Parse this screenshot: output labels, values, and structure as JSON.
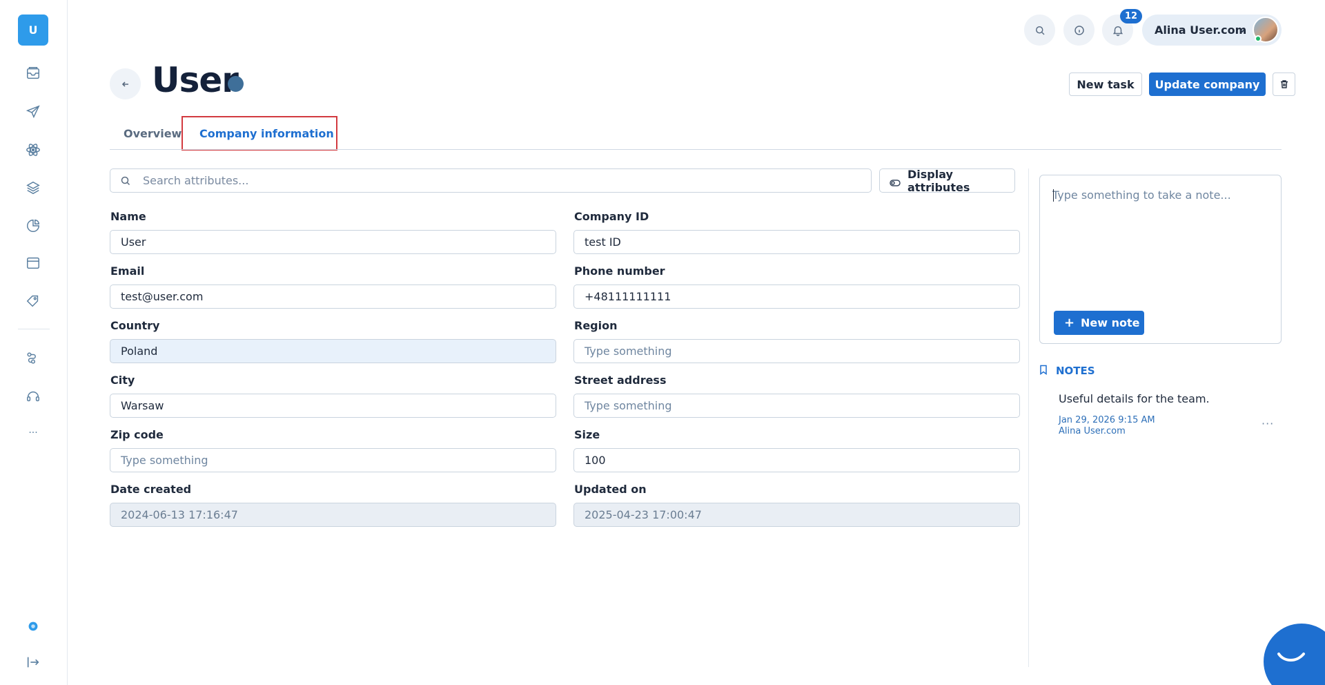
{
  "sidebar": {
    "logo_letter": "U",
    "icons": [
      "inbox-icon",
      "send-icon",
      "atom-icon",
      "layers-icon",
      "chart-pie-icon",
      "browser-window-icon",
      "tag-icon",
      "flow-icon",
      "headset-icon",
      "more-icon",
      "help-dot-icon",
      "logout-icon"
    ],
    "more_label": "···"
  },
  "topbar": {
    "notification_count": "12",
    "user_name": "Alina User.com"
  },
  "header": {
    "title": "User",
    "new_task_label": "New task",
    "update_company_label": "Update company"
  },
  "tabs": [
    {
      "label": "Overview"
    },
    {
      "label": "Company information"
    }
  ],
  "search": {
    "placeholder": "Search attributes...",
    "display_attributes_label": "Display attributes"
  },
  "form": {
    "name": {
      "label": "Name",
      "value": "User"
    },
    "company_id": {
      "label": "Company ID",
      "value": "test ID"
    },
    "email": {
      "label": "Email",
      "value": "test@user.com"
    },
    "phone": {
      "label": "Phone number",
      "value": "+48111111111"
    },
    "country": {
      "label": "Country",
      "value": "Poland"
    },
    "region": {
      "label": "Region",
      "placeholder": "Type something"
    },
    "city": {
      "label": "City",
      "value": "Warsaw"
    },
    "street": {
      "label": "Street address",
      "placeholder": "Type something"
    },
    "zip": {
      "label": "Zip code",
      "placeholder": "Type something"
    },
    "size": {
      "label": "Size",
      "value": "100"
    },
    "date_created": {
      "label": "Date created",
      "value": "2024-06-13 17:16:47"
    },
    "updated_on": {
      "label": "Updated on",
      "value": "2025-04-23 17:00:47"
    }
  },
  "notes_panel": {
    "placeholder": "Type something to take a note...",
    "new_note_label": "New note",
    "heading": "NOTES",
    "items": [
      {
        "text": "Useful details for the team.",
        "date": "Jan 29, 2026 9:15 AM",
        "author": "Alina User.com"
      }
    ]
  },
  "colors": {
    "primary": "#1e6fd0",
    "tab_highlight": "#d2393f",
    "logo": "#2e9bea"
  }
}
